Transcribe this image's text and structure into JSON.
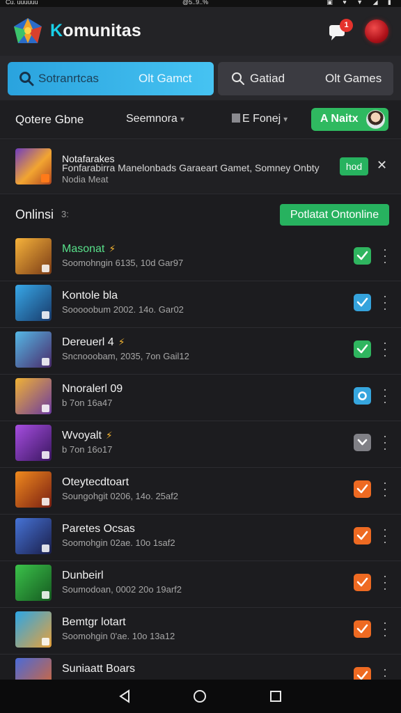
{
  "status_bar": {
    "left": "Cu. uuuuuu",
    "middle": "@5..9..%",
    "right": "▣ ♥ ▼ ◢ ▮"
  },
  "app": {
    "title_prefix": "K",
    "title_rest": "omunitas",
    "notification_count": "1"
  },
  "tabs": [
    {
      "icon": "search-icon",
      "label1": "Sotranrtcas",
      "label2": "Olt Gamct"
    },
    {
      "icon": "search-icon",
      "label1": "Gatiad",
      "label2": "Olt Games"
    }
  ],
  "filters": {
    "label": "Qotere Gbne",
    "dropdown1": "Seemnora",
    "dropdown2": "E Fonej",
    "new_button": "A Naitx"
  },
  "featured": {
    "title": "Notafarakes",
    "description": "Fonfarabirra Manelonbads Garaeart Gamet, Somney Onbty",
    "subtitle": "Nodia Meat",
    "badge": "hod",
    "close": "✕"
  },
  "online": {
    "label": "Onlinsi",
    "count": "3:",
    "button": "Potlatat Ontonline"
  },
  "games": [
    {
      "title": "Masonat",
      "spark": "⚡",
      "sub": "Soomohngin 6135, 10d Gar97",
      "check_color": "#2fb55f",
      "check": "check-icon",
      "thumb_a": "#f6b33b",
      "thumb_b": "#7a3b16",
      "green_title": true
    },
    {
      "title": "Kontole bla",
      "spark": "",
      "sub": "Sooooobum 2002. 14o. Gar02",
      "check_color": "#35a3dc",
      "check": "check-icon",
      "thumb_a": "#38a8e8",
      "thumb_b": "#183a6a",
      "green_title": false
    },
    {
      "title": "Dereuerl 4",
      "spark": "⚡",
      "sub": "Sncnooobam, 2035, 7on Gail12",
      "check_color": "#2fb55f",
      "check": "check-icon",
      "thumb_a": "#55b8e6",
      "thumb_b": "#4a2a6a",
      "green_title": false
    },
    {
      "title": "Nnoralerl 09",
      "spark": "",
      "sub": "b 7on 16a47",
      "check_color": "#36a6de",
      "check": "ring-icon",
      "thumb_a": "#f0b235",
      "thumb_b": "#6b3aa0",
      "green_title": false
    },
    {
      "title": "Wvoyalt",
      "spark": "⚡",
      "sub": "b 7on 16o17",
      "check_color": "#808086",
      "check": "chevron-icon",
      "thumb_a": "#a64ee0",
      "thumb_b": "#3a1660",
      "green_title": false
    },
    {
      "title": "Oteytecdtoart",
      "spark": "",
      "sub": "Soungohgit 0206, 14o. 25af2",
      "check_color": "#ee6a22",
      "check": "check-icon",
      "thumb_a": "#f08a1e",
      "thumb_b": "#7a1f12",
      "green_title": false
    },
    {
      "title": "Paretes Ocsas",
      "spark": "",
      "sub": "Soomohgin 02ae. 10o 1saf2",
      "check_color": "#ee6a22",
      "check": "check-icon",
      "thumb_a": "#4673d6",
      "thumb_b": "#1a1e4a",
      "green_title": false
    },
    {
      "title": "Dunbeirl",
      "spark": "",
      "sub": "Soumodoan, 0002 20o 19arf2",
      "check_color": "#ee6a22",
      "check": "check-icon",
      "thumb_a": "#3bc24a",
      "thumb_b": "#155a20",
      "green_title": false
    },
    {
      "title": "Bemtgr lotart",
      "spark": "",
      "sub": "Soomohgin 0'ae. 10o 13a12",
      "check_color": "#ee6a22",
      "check": "check-icon",
      "thumb_a": "#2ca6e6",
      "thumb_b": "#e8a13a",
      "green_title": false
    },
    {
      "title": "Suniaatt Boars",
      "spark": "",
      "sub": "",
      "check_color": "#ee6a22",
      "check": "check-icon",
      "thumb_a": "#4a6ad8",
      "thumb_b": "#e0672a",
      "green_title": false
    }
  ],
  "nav": {
    "back": "back-icon",
    "home": "home-icon",
    "recent": "recent-apps-icon"
  }
}
